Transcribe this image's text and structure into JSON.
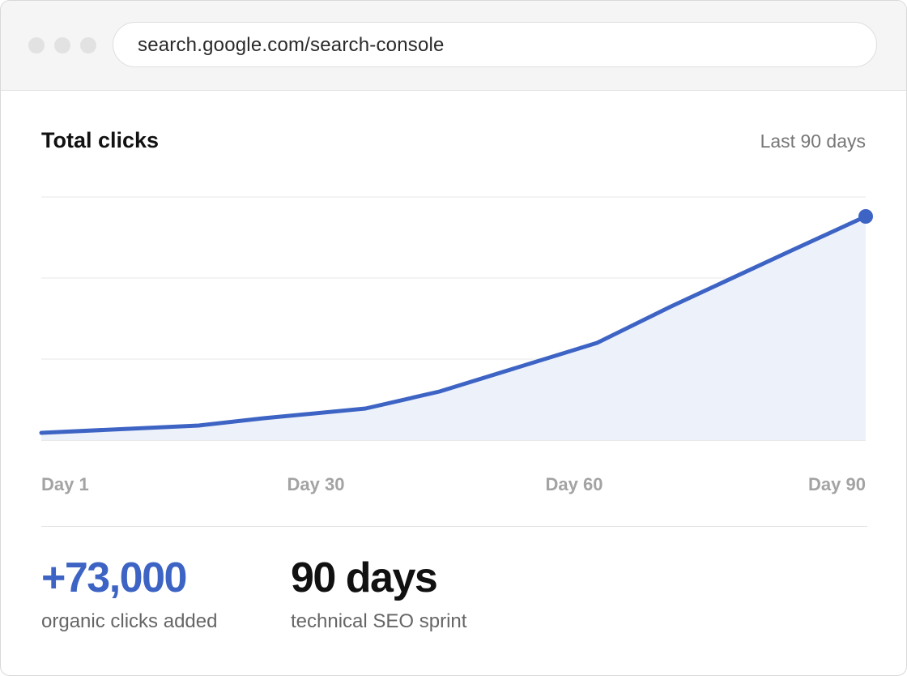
{
  "browser": {
    "url": "search.google.com/search-console"
  },
  "card": {
    "title": "Total clicks",
    "range": "Last 90 days"
  },
  "chart_data": {
    "type": "area",
    "title": "Total clicks",
    "x_tick_labels": [
      "Day 1",
      "Day 30",
      "Day 60",
      "Day 90"
    ],
    "x": [
      1,
      18,
      25,
      36,
      44,
      61,
      69,
      82,
      90
    ],
    "y": [
      3,
      6,
      9,
      13,
      20,
      40,
      55,
      78,
      92
    ],
    "y_unit": "relative (0-100, no printed y-axis)",
    "ylim": [
      0,
      100
    ],
    "gridlines": 4,
    "line_color": "#3d64c4",
    "fill_color": "#edf1fa",
    "end_marker": true
  },
  "stats": [
    {
      "value": "+73,000",
      "label": "organic clicks added",
      "color": "#3d64c4"
    },
    {
      "value": "90 days",
      "label": "technical SEO sprint",
      "color": "#111111"
    }
  ]
}
